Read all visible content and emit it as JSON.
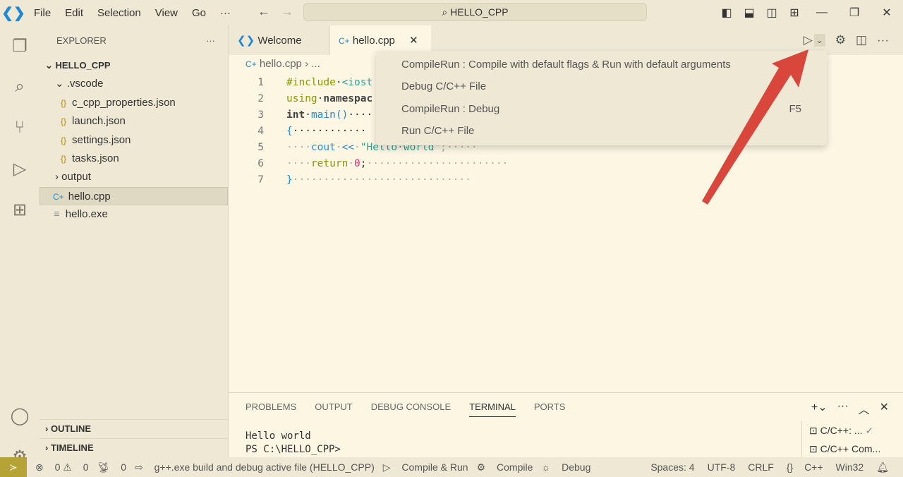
{
  "titlebar": {
    "menu": [
      "File",
      "Edit",
      "Selection",
      "View",
      "Go",
      "···"
    ],
    "search": "HELLO_CPP"
  },
  "explorer": {
    "title": "EXPLORER",
    "more": "···",
    "root": "HELLO_CPP",
    "items": [
      {
        "label": ".vscode",
        "type": "folder-open"
      },
      {
        "label": "c_cpp_properties.json",
        "type": "json"
      },
      {
        "label": "launch.json",
        "type": "json"
      },
      {
        "label": "settings.json",
        "type": "json"
      },
      {
        "label": "tasks.json",
        "type": "json"
      },
      {
        "label": "output",
        "type": "folder"
      },
      {
        "label": "hello.cpp",
        "type": "cpp",
        "selected": true
      },
      {
        "label": "hello.exe",
        "type": "file"
      }
    ],
    "outline": "OUTLINE",
    "timeline": "TIMELINE"
  },
  "tabs": [
    {
      "label": "Welcome"
    },
    {
      "label": "hello.cpp",
      "active": true
    }
  ],
  "breadcrumb": {
    "file": "hello.cpp",
    "rest": "..."
  },
  "code": {
    "line_numbers": [
      "1",
      "2",
      "3",
      "4",
      "5",
      "6",
      "7"
    ]
  },
  "dropdown": [
    {
      "label": "CompileRun : Compile with default flags & Run with default arguments",
      "key": "F6"
    },
    {
      "label": "Debug C/C++ File",
      "key": ""
    },
    {
      "label": "CompileRun : Debug",
      "key": "F5"
    },
    {
      "label": "Run C/C++ File",
      "key": ""
    }
  ],
  "panel": {
    "tabs": [
      "PROBLEMS",
      "OUTPUT",
      "DEBUG CONSOLE",
      "TERMINAL",
      "PORTS"
    ],
    "active": "TERMINAL",
    "terminal": [
      "Hello world",
      "PS C:\\HELLO_CPP>"
    ],
    "terminals": [
      "C/C++: ...",
      "C/C++ Com..."
    ]
  },
  "status": {
    "errors": "0",
    "warnings": "0",
    "ports": "0",
    "task": "g++.exe build and debug active file (HELLO_CPP)",
    "compile_run": "Compile & Run",
    "compile": "Compile",
    "debug": "Debug",
    "spaces": "Spaces: 4",
    "encoding": "UTF-8",
    "eol": "CRLF",
    "language": "C++",
    "platform": "Win32"
  },
  "colors": {
    "accent": "#b5a336",
    "arrow": "#d9463b",
    "background": "#fdf6e3"
  }
}
